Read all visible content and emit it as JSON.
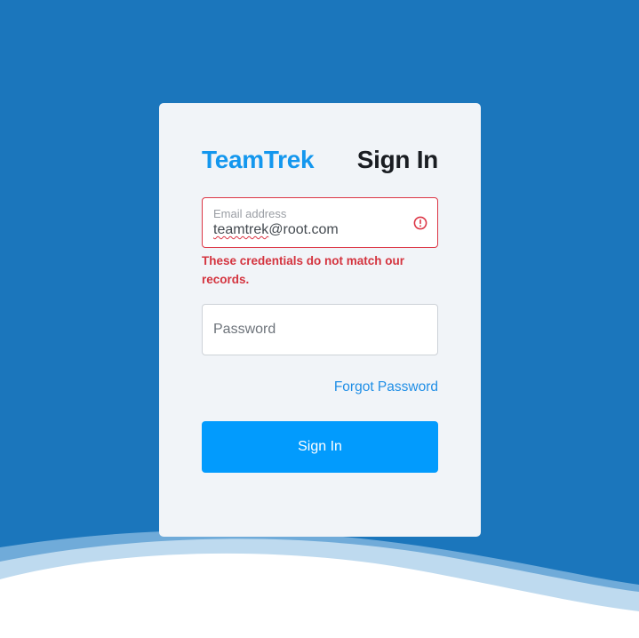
{
  "brand": {
    "name": "TeamTrek"
  },
  "form": {
    "title": "Sign In",
    "email": {
      "label": "Email address",
      "value_part1": "teamtrek",
      "value_part2": "@root.com",
      "state": "error"
    },
    "error_message": "These credentials do not match our records.",
    "password": {
      "placeholder": "Password"
    },
    "forgot_password": "Forgot Password",
    "submit_label": "Sign In"
  },
  "colors": {
    "background": "#1b76bc",
    "card": "#f1f4f8",
    "brand": "#1497ee",
    "error": "#dc3545",
    "primary_button": "#029bfd"
  },
  "icons": {
    "email_status": "alert-circle-icon"
  }
}
